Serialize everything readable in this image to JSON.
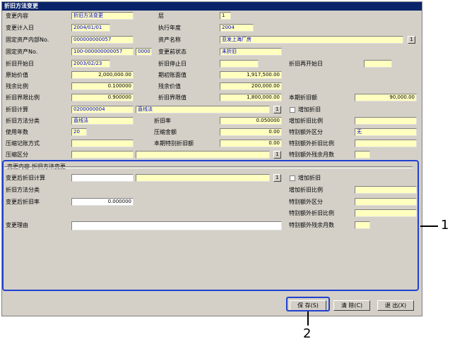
{
  "window": {
    "title": "折旧方法变更"
  },
  "rows": {
    "r1": {
      "l1": "变更内容",
      "v1": "折旧方法变更",
      "l2": "层",
      "v2": "1"
    },
    "r2": {
      "l1": "变更计入日",
      "v1": "2004/01/01",
      "l2": "执行年度",
      "v2": "2004"
    },
    "r3": {
      "l1": "固定资产内部No.",
      "v1": "000000000057",
      "l2": "资产名称",
      "v2": "亚发上海厂房"
    },
    "r4": {
      "l1": "固定资产No.",
      "v1": "100-000000000057",
      "v1b": "0000",
      "l2": "变更前状态",
      "v2": "未折旧"
    },
    "r5": {
      "l1": "折旧开始日",
      "v1": "2003/02/23",
      "l2": "折旧停止日",
      "v2": "",
      "l3": "折旧再开始日",
      "v3": ""
    },
    "r6": {
      "l1": "原始价值",
      "v1": "2,000,000.00",
      "l2": "期初账面值",
      "v2": "1,917,500.00"
    },
    "r7": {
      "l1": "残余比例",
      "v1": "0.100000",
      "l2": "残余价值",
      "v2": "200,000.00"
    },
    "r8": {
      "l1": "折旧界限比例",
      "v1": "0.900000",
      "l2": "折旧界限值",
      "v2": "1,800,000.00",
      "l3": "本期折旧额",
      "v3": "90,000.00"
    },
    "r9": {
      "l1": "折旧计算",
      "v1": "0200000004",
      "v1b": "直线法",
      "l3": "增加折旧"
    },
    "r10": {
      "l1": "折旧方法分类",
      "v1": "直线法",
      "l2": "折旧率",
      "v2": "0.050000",
      "l3": "增加折旧比例",
      "v3": ""
    },
    "r11": {
      "l1": "使用年数",
      "v1": "20",
      "l2": "压缩金额",
      "v2": "0.00",
      "l3": "特别额外区分",
      "v3": "无"
    },
    "r12": {
      "l1": "压缩记账方式",
      "v1": "",
      "l2": "本期特别折旧额",
      "v2": "0.00",
      "l3": "特别额外折旧比例",
      "v3": ""
    },
    "r13": {
      "l1": "压缩区分",
      "v1": "",
      "v1b": "",
      "l3": "特别额外残余月数",
      "v3": ""
    }
  },
  "group": {
    "title": "变更内容-折旧方法变更",
    "calc_label": "变更后折旧计算",
    "calc_value": "",
    "calc_value_b": "",
    "add_dep_label": "增加折旧",
    "class_label": "折旧方法分类",
    "rate_label": "变更后折旧率",
    "rate_value": "0.000000",
    "add_ratio_label": "增加折旧比例",
    "special_class_label": "特别额外区分",
    "special_ratio_label": "特别额外折旧比例",
    "reason_label": "变更理由",
    "reason_value": "",
    "special_months_label": "特别额外残余月数"
  },
  "buttons": {
    "ellipsis": "1",
    "save": "保 存(S)",
    "delete": "清 除(C)",
    "exit": "退 出(X)"
  },
  "callouts": {
    "one": "1",
    "two": "2"
  },
  "colors": {
    "field": "#ffffc0",
    "highlight": "#2040d0",
    "titlebar": "#0a246a"
  }
}
